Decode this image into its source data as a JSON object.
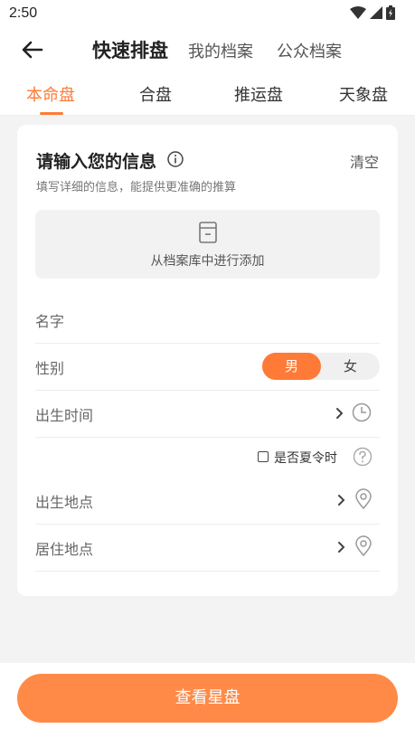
{
  "status": {
    "time": "2:50"
  },
  "nav": {
    "title": "快速排盘",
    "links": [
      "我的档案",
      "公众档案"
    ]
  },
  "tabs": [
    {
      "label": "本命盘",
      "active": true
    },
    {
      "label": "合盘",
      "active": false
    },
    {
      "label": "推运盘",
      "active": false
    },
    {
      "label": "天象盘",
      "active": false
    }
  ],
  "card": {
    "title": "请输入您的信息",
    "clear_label": "清空",
    "subtitle": "填写详细的信息，能提供更准确的推算",
    "archive_label": "从档案库中进行添加"
  },
  "form": {
    "name_placeholder": "名字",
    "gender_label": "性别",
    "gender_options": [
      "男",
      "女"
    ],
    "gender_selected": "男",
    "birth_time_label": "出生时间",
    "dst_label": "是否夏令时",
    "dst_checked": false,
    "birth_place_label": "出生地点",
    "residence_label": "居住地点"
  },
  "submit_label": "查看星盘",
  "colors": {
    "accent": "#ff7a36",
    "button": "#ff8a48"
  }
}
